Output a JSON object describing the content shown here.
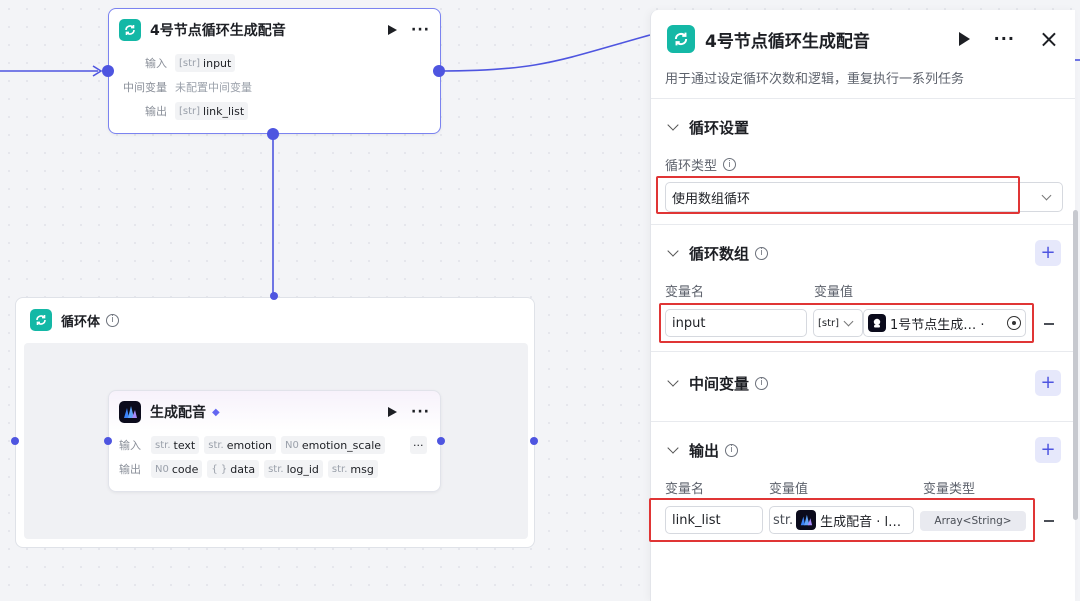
{
  "loop_node": {
    "title": "4号节点循环生成配音",
    "input_label": "输入",
    "input_type": "[str]",
    "input_value": "input",
    "mid_label": "中间变量",
    "mid_value": "未配置中间变量",
    "output_label": "输出",
    "output_type": "[str]",
    "output_value": "link_list"
  },
  "loop_body": {
    "title": "循环体",
    "info_icon": "ⓘ"
  },
  "dubbing_node": {
    "title": "生成配音",
    "input_label": "输入",
    "inputs": [
      {
        "type": "str.",
        "name": "text"
      },
      {
        "type": "str.",
        "name": "emotion"
      },
      {
        "type": "N0",
        "name": "emotion_scale"
      }
    ],
    "more": "···",
    "output_label": "输出",
    "outputs": [
      {
        "type": "N0",
        "name": "code"
      },
      {
        "type": "{ }",
        "name": "data"
      },
      {
        "type": "str.",
        "name": "log_id"
      },
      {
        "type": "str.",
        "name": "msg"
      }
    ]
  },
  "panel": {
    "title": "4号节点循环生成配音",
    "description": "用于通过设定循环次数和逻辑，重复执行一系列任务",
    "close_icon": "×",
    "loop_settings": {
      "title": "循环设置",
      "type_label": "循环类型",
      "type_value": "使用数组循环"
    },
    "loop_array": {
      "title": "循环数组",
      "col_name": "变量名",
      "col_value": "变量值",
      "var_name": "input",
      "var_type": "[str]",
      "var_ref": "1号节点生成… ·"
    },
    "mid_vars": {
      "title": "中间变量"
    },
    "output": {
      "title": "输出",
      "col_name": "变量名",
      "col_value": "变量值",
      "col_type": "变量类型",
      "var_name": "link_list",
      "var_type_prefix": "str.",
      "var_ref": "生成配音 · l…",
      "var_type": "Array<String>"
    }
  },
  "colors": {
    "accent": "#4e55e0",
    "loop_icon": "#14b8a6",
    "highlight": "#e03535"
  }
}
